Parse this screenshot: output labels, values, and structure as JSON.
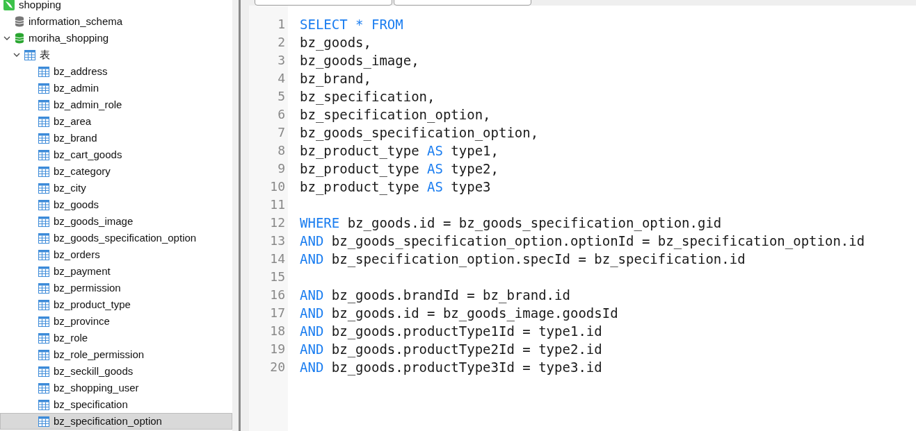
{
  "tree": [
    {
      "kind": "connection",
      "label": "shopping",
      "children": [
        {
          "kind": "database",
          "label": "information_schema",
          "open": false
        },
        {
          "kind": "database",
          "label": "moriha_shopping",
          "open": true,
          "expanded": true,
          "children": [
            {
              "kind": "group",
              "label": "表",
              "expanded": true,
              "children": [
                {
                  "kind": "table",
                  "label": "bz_address",
                  "selected": false
                },
                {
                  "kind": "table",
                  "label": "bz_admin",
                  "selected": false
                },
                {
                  "kind": "table",
                  "label": "bz_admin_role",
                  "selected": false
                },
                {
                  "kind": "table",
                  "label": "bz_area",
                  "selected": false
                },
                {
                  "kind": "table",
                  "label": "bz_brand",
                  "selected": false
                },
                {
                  "kind": "table",
                  "label": "bz_cart_goods",
                  "selected": false
                },
                {
                  "kind": "table",
                  "label": "bz_category",
                  "selected": false
                },
                {
                  "kind": "table",
                  "label": "bz_city",
                  "selected": false
                },
                {
                  "kind": "table",
                  "label": "bz_goods",
                  "selected": false
                },
                {
                  "kind": "table",
                  "label": "bz_goods_image",
                  "selected": false
                },
                {
                  "kind": "table",
                  "label": "bz_goods_specification_option",
                  "selected": false
                },
                {
                  "kind": "table",
                  "label": "bz_orders",
                  "selected": false
                },
                {
                  "kind": "table",
                  "label": "bz_payment",
                  "selected": false
                },
                {
                  "kind": "table",
                  "label": "bz_permission",
                  "selected": false
                },
                {
                  "kind": "table",
                  "label": "bz_product_type",
                  "selected": false
                },
                {
                  "kind": "table",
                  "label": "bz_province",
                  "selected": false
                },
                {
                  "kind": "table",
                  "label": "bz_role",
                  "selected": false
                },
                {
                  "kind": "table",
                  "label": "bz_role_permission",
                  "selected": false
                },
                {
                  "kind": "table",
                  "label": "bz_seckill_goods",
                  "selected": false
                },
                {
                  "kind": "table",
                  "label": "bz_shopping_user",
                  "selected": false
                },
                {
                  "kind": "table",
                  "label": "bz_specification",
                  "selected": false
                },
                {
                  "kind": "table",
                  "label": "bz_specification_option",
                  "selected": true
                }
              ]
            }
          ]
        }
      ]
    }
  ],
  "editor": {
    "lines": [
      {
        "number": "1",
        "tokens": [
          {
            "kind": "keyword",
            "text": "SELECT * FROM"
          }
        ]
      },
      {
        "number": "2",
        "tokens": [
          {
            "kind": "plain",
            "text": "bz_goods,"
          }
        ]
      },
      {
        "number": "3",
        "tokens": [
          {
            "kind": "plain",
            "text": "bz_goods_image,"
          }
        ]
      },
      {
        "number": "4",
        "tokens": [
          {
            "kind": "plain",
            "text": "bz_brand,"
          }
        ]
      },
      {
        "number": "5",
        "tokens": [
          {
            "kind": "plain",
            "text": "bz_specification,"
          }
        ]
      },
      {
        "number": "6",
        "tokens": [
          {
            "kind": "plain",
            "text": "bz_specification_option,"
          }
        ]
      },
      {
        "number": "7",
        "tokens": [
          {
            "kind": "plain",
            "text": "bz_goods_specification_option,"
          }
        ]
      },
      {
        "number": "8",
        "tokens": [
          {
            "kind": "plain",
            "text": "bz_product_type "
          },
          {
            "kind": "keyword",
            "text": "AS"
          },
          {
            "kind": "plain",
            "text": " type1,"
          }
        ]
      },
      {
        "number": "9",
        "tokens": [
          {
            "kind": "plain",
            "text": "bz_product_type "
          },
          {
            "kind": "keyword",
            "text": "AS"
          },
          {
            "kind": "plain",
            "text": " type2,"
          }
        ]
      },
      {
        "number": "10",
        "tokens": [
          {
            "kind": "plain",
            "text": "bz_product_type "
          },
          {
            "kind": "keyword",
            "text": "AS"
          },
          {
            "kind": "plain",
            "text": " type3"
          }
        ]
      },
      {
        "number": "11"
      },
      {
        "number": "12",
        "tokens": [
          {
            "kind": "keyword",
            "text": "WHERE"
          },
          {
            "kind": "plain",
            "text": " bz_goods.id = bz_goods_specification_option.gid"
          }
        ]
      },
      {
        "number": "13",
        "tokens": [
          {
            "kind": "keyword",
            "text": "AND"
          },
          {
            "kind": "plain",
            "text": " bz_goods_specification_option.optionId = bz_specification_option.id"
          }
        ]
      },
      {
        "number": "14",
        "tokens": [
          {
            "kind": "keyword",
            "text": "AND"
          },
          {
            "kind": "plain",
            "text": " bz_specification_option.specId = bz_specification.id"
          }
        ]
      },
      {
        "number": "15"
      },
      {
        "number": "16",
        "tokens": [
          {
            "kind": "keyword",
            "text": "AND"
          },
          {
            "kind": "plain",
            "text": " bz_goods.brandId = bz_brand.id"
          }
        ]
      },
      {
        "number": "17",
        "tokens": [
          {
            "kind": "keyword",
            "text": "AND"
          },
          {
            "kind": "plain",
            "text": " bz_goods.id = bz_goods_image.goodsId"
          }
        ]
      },
      {
        "number": "18",
        "tokens": [
          {
            "kind": "keyword",
            "text": "AND"
          },
          {
            "kind": "plain",
            "text": " bz_goods.productType1Id = type1.id"
          }
        ]
      },
      {
        "number": "19",
        "tokens": [
          {
            "kind": "keyword",
            "text": "AND"
          },
          {
            "kind": "plain",
            "text": " bz_goods.productType2Id = type2.id"
          }
        ]
      },
      {
        "number": "20",
        "tokens": [
          {
            "kind": "keyword",
            "text": "AND"
          },
          {
            "kind": "plain",
            "text": " bz_goods.productType3Id = type3.id"
          }
        ]
      }
    ]
  }
}
